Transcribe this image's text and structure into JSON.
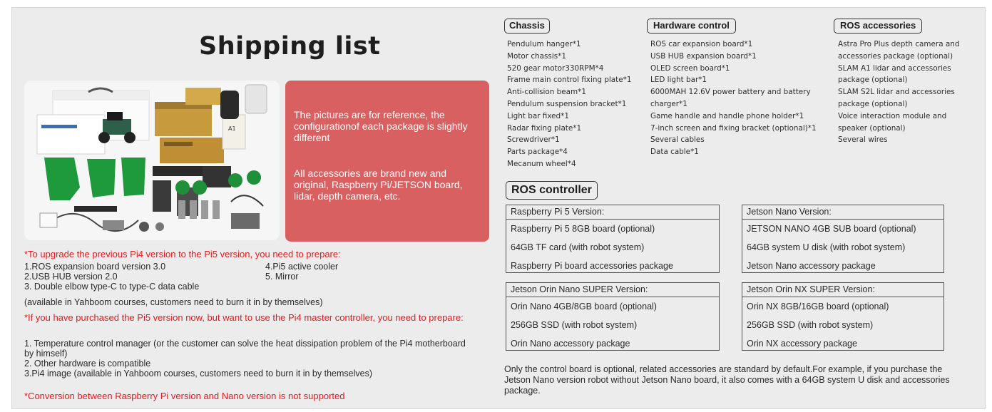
{
  "title": "Shipping list",
  "note": {
    "p1": "The pictures are for reference, the configurationof each package is slightly different",
    "p2": "All accessories are brand new and original, Raspberry Pi/JETSON board, lidar, depth camera, etc."
  },
  "upgrade": {
    "heading": "*To upgrade the previous Pi4 version to the Pi5 version, you need to prepare:",
    "items_left": [
      "1.ROS expansion board version 3.0",
      "2.USB HUB version 2.0",
      "3. Double elbow type-C to type-C data cable"
    ],
    "items_right": [
      "4.Pi5 active cooler",
      "5. Mirror"
    ],
    "note": "(available in Yahboom courses, customers need to burn it in by themselves)"
  },
  "downgrade": {
    "heading": "*If you have purchased the Pi5 version now, but want to use the Pi4 master controller, you need to prepare:",
    "items": [
      "1. Temperature control manager (or the customer can solve the heat dissipation problem of the Pi4 motherboard by himself)",
      "2. Other hardware is compatible",
      "3.Pi4 image (available in Yahboom courses, customers need to burn it in by themselves)"
    ]
  },
  "not_supported": "*Conversion between Raspberry Pi version and Nano version is not supported",
  "chassis": {
    "title": "Chassis",
    "items": [
      "Pendulum hanger*1",
      "Motor chassis*1",
      "520 gear motor330RPM*4",
      "Frame main control fixing plate*1",
      "Anti-collision beam*1",
      "Pendulum suspension bracket*1",
      "Light bar fixed*1",
      "Radar fixing plate*1",
      "Screwdriver*1",
      "Parts package*4",
      "Mecanum wheel*4"
    ]
  },
  "hardware": {
    "title": "Hardware control",
    "items": [
      "ROS car expansion board*1",
      "USB HUB expansion board*1",
      "OLED screen board*1",
      "LED light bar*1",
      "6000MAH 12.6V power battery and battery",
      "charger*1",
      "Game handle and handle phone holder*1",
      "7-inch screen and fixing bracket (optional)*1",
      "Several cables",
      "Data cable*1"
    ]
  },
  "ros_acc": {
    "title": "ROS accessories",
    "items": [
      "Astra Pro Plus depth camera and",
      "accessories package (optional)",
      "SLAM A1 lidar and accessories",
      "package (optional)",
      "SLAM S2L lidar and accessories",
      "package (optional)",
      "Voice interaction module and",
      "speaker (optional)",
      "Several wires"
    ]
  },
  "controller": {
    "title": "ROS controller",
    "tables": [
      {
        "header": "Raspberry Pi 5 Version:",
        "rows": [
          "Raspberry Pi 5 8GB board (optional)",
          "64GB TF card (with robot system)",
          "Raspberry Pi board accessories package"
        ]
      },
      {
        "header": "Jetson Nano Version:",
        "rows": [
          "JETSON NANO 4GB SUB board (optional)",
          "64GB system U disk (with robot system)",
          "Jetson Nano accessory package"
        ]
      },
      {
        "header": "Jetson Orin Nano SUPER Version:",
        "rows": [
          "Orin Nano 4GB/8GB board (optional)",
          "256GB SSD (with robot system)",
          "Orin Nano accessory package"
        ]
      },
      {
        "header": "Jetson Orin NX SUPER Version:",
        "rows": [
          "Orin NX 8GB/16GB board (optional)",
          "256GB SSD (with robot system)",
          "Orin NX accessory package"
        ]
      }
    ]
  },
  "bottom_note": "Only the control board is optional, related accessories are standard by default.For example, if you purchase the Jetson Nano version robot without Jetson Nano board, it also comes with a 64GB system U disk and accessories package.",
  "colors": {
    "panel": "#ececec",
    "note_bg": "#d96060",
    "red_text": "#e31b1b",
    "accent_green": "#1e9a3c"
  }
}
